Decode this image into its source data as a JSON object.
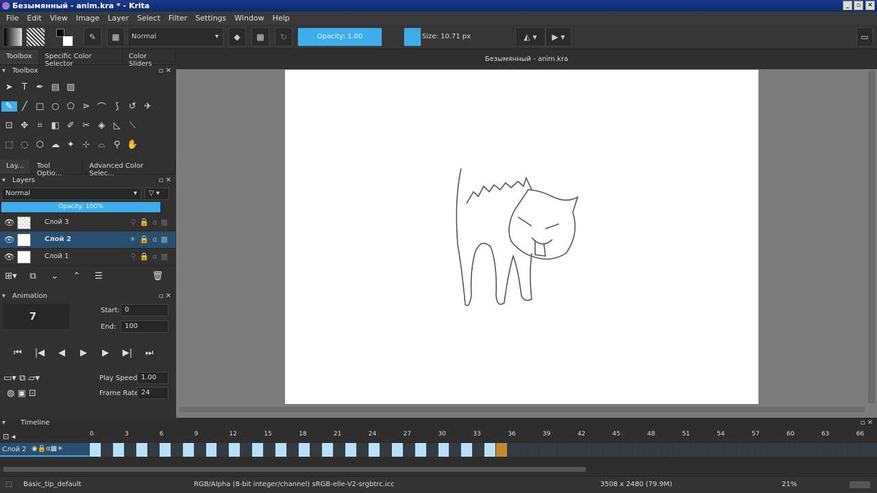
{
  "window": {
    "title": "Безымянный - anim.kra * - Krita",
    "controls": [
      "_",
      "▫",
      "✕"
    ]
  },
  "menu": [
    "File",
    "Edit",
    "View",
    "Image",
    "Layer",
    "Select",
    "Filter",
    "Settings",
    "Window",
    "Help"
  ],
  "toolbar": {
    "blend_mode": "Normal",
    "opacity": "Opacity:  1.00",
    "size": "Size:  10.71 px"
  },
  "left_tabs": [
    "Toolbox",
    "Specific Color Selector",
    "Color Sliders"
  ],
  "toolbox": {
    "title": "Toolbox"
  },
  "mid_tabs": [
    "Lay...",
    "Tool Optio...",
    "Advanced Color Selec..."
  ],
  "layers": {
    "title": "Layers",
    "blend_mode": "Normal",
    "opacity": "Opacity:  100%",
    "items": [
      {
        "name": "Слой 3"
      },
      {
        "name": "Слой 2",
        "selected": true
      },
      {
        "name": "Слой 1"
      }
    ]
  },
  "animation": {
    "title": "Animation",
    "current_frame": "7",
    "start_label": "Start:",
    "start": "0",
    "end_label": "End:",
    "end": "100",
    "play_speed_label": "Play Speed:",
    "play_speed": "1.00",
    "frame_rate_label": "Frame Rate:",
    "frame_rate": "24"
  },
  "document": {
    "title": "Безымянный - anim.kra"
  },
  "timeline": {
    "title": "Timeline",
    "layer": "Слой 2",
    "ticks": [
      "0",
      "3",
      "6",
      "9",
      "12",
      "15",
      "18",
      "21",
      "24",
      "27",
      "30",
      "33",
      "36",
      "39",
      "42",
      "45",
      "48",
      "51",
      "54",
      "57",
      "60",
      "63",
      "66"
    ],
    "keyframes": [
      0,
      2,
      4,
      6,
      8,
      10,
      12,
      14,
      16,
      18,
      20,
      22,
      24,
      26,
      28,
      30,
      32,
      34
    ],
    "current_frame_marker": 35,
    "keyframe_color": "#b8e0f8",
    "current_color": "#c8872c"
  },
  "status": {
    "brush": "Basic_tip_default",
    "color_space": "RGB/Alpha (8-bit integer/channel)  sRGB-elle-V2-srgbtrc.icc",
    "dimensions": "3508 x 2480 (79.9M)",
    "zoom": "21%"
  }
}
